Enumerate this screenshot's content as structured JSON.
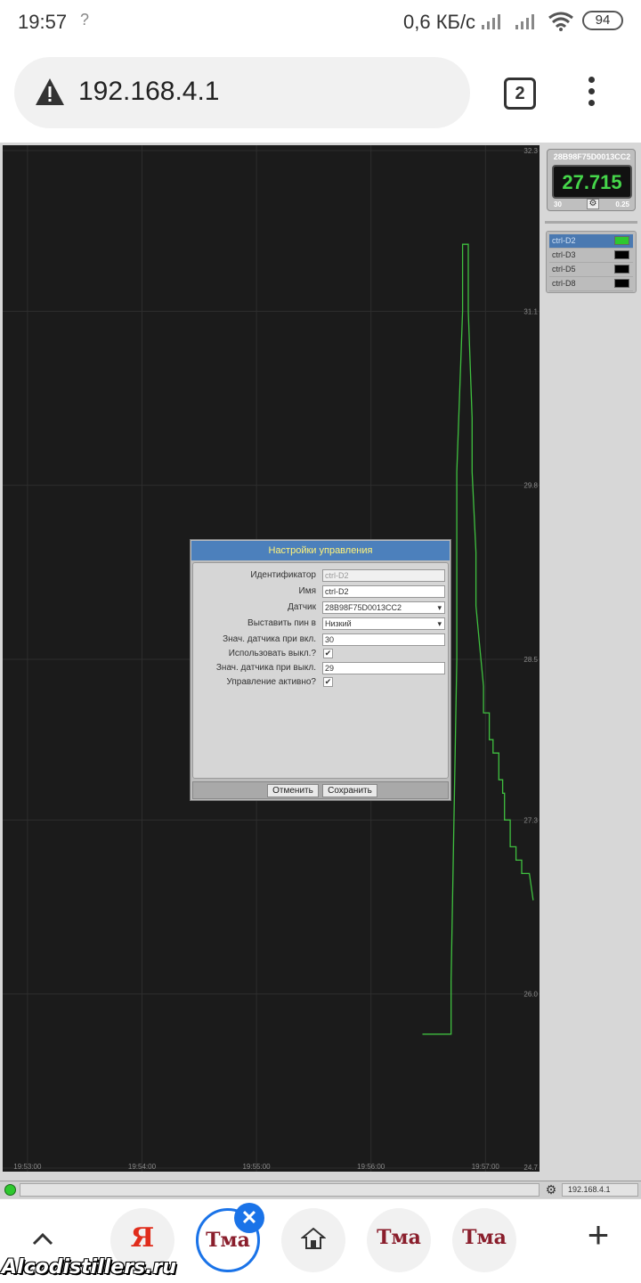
{
  "status_bar": {
    "time": "19:57",
    "net_speed": "0,6 КБ/с",
    "battery": "94",
    "question_glyph": "?"
  },
  "browser": {
    "url": "192.168.4.1",
    "tab_count": "2"
  },
  "gauge": {
    "sensor_id": "28B98F75D0013CC2",
    "value": "27.715",
    "min": "30",
    "step": "0.25"
  },
  "controls": [
    {
      "name": "ctrl-D2",
      "selected": true,
      "color": "#2ec82e"
    },
    {
      "name": "ctrl-D3",
      "selected": false,
      "color": "#000000"
    },
    {
      "name": "ctrl-D5",
      "selected": false,
      "color": "#000000"
    },
    {
      "name": "ctrl-D8",
      "selected": false,
      "color": "#000000"
    }
  ],
  "footer": {
    "ip": "192.168.4.1"
  },
  "dialog": {
    "title": "Настройки управления",
    "fields": {
      "id_label": "Идентификатор",
      "id_value": "ctrl-D2",
      "name_label": "Имя",
      "name_value": "ctrl-D2",
      "sensor_label": "Датчик",
      "sensor_value": "28B98F75D0013CC2",
      "pin_label": "Выставить пин в",
      "pin_value": "Низкий",
      "on_label": "Знач. датчика при вкл.",
      "on_value": "30",
      "use_off_label": "Использовать выкл.?",
      "off_label": "Знач. датчика при выкл.",
      "off_value": "29",
      "active_label": "Управление активно?"
    },
    "cancel": "Отменить",
    "save": "Сохранить"
  },
  "nav": {
    "ya_glyph": "Я",
    "tma_glyph": "Тма",
    "close": "✕",
    "plus": "+"
  },
  "watermark": "Alcodistillers.ru",
  "chart_data": {
    "type": "line",
    "title": "",
    "xlabel": "",
    "ylabel": "",
    "x_ticks": [
      "19:53:00",
      "19:54:00",
      "19:55:00",
      "19:56:00",
      "19:57:00"
    ],
    "y_ticks": [
      "32.3",
      "31.1",
      "29.8",
      "28.5",
      "27.3",
      "26.0",
      "24.7"
    ],
    "ylim": [
      24.7,
      32.3
    ],
    "grid": true,
    "series": [
      {
        "color": "#3fbf3f",
        "x": [
          "19:56:27",
          "19:56:42",
          "19:56:42",
          "19:56:45",
          "19:56:45",
          "19:56:48",
          "19:56:48",
          "19:56:51",
          "19:56:51",
          "19:56:53",
          "19:56:53",
          "19:56:55",
          "19:56:55",
          "19:56:57",
          "19:56:59",
          "19:56:59",
          "19:57:02",
          "19:57:02",
          "19:57:04",
          "19:57:04",
          "19:57:07",
          "19:57:07",
          "19:57:09",
          "19:57:09",
          "19:57:10",
          "19:57:10",
          "19:57:13",
          "19:57:13",
          "19:57:16",
          "19:57:16",
          "19:57:19",
          "19:57:19",
          "19:57:23",
          "19:57:23",
          "19:57:25"
        ],
        "y": [
          25.7,
          25.7,
          26.1,
          28.5,
          29.9,
          31.1,
          31.6,
          31.6,
          31.1,
          30.3,
          29.9,
          29.3,
          28.9,
          28.6,
          28.3,
          28.1,
          28.1,
          27.9,
          27.9,
          27.8,
          27.8,
          27.6,
          27.6,
          27.5,
          27.5,
          27.3,
          27.3,
          27.1,
          27.1,
          27.0,
          27.0,
          26.9,
          26.9,
          26.9,
          26.7
        ]
      }
    ]
  }
}
